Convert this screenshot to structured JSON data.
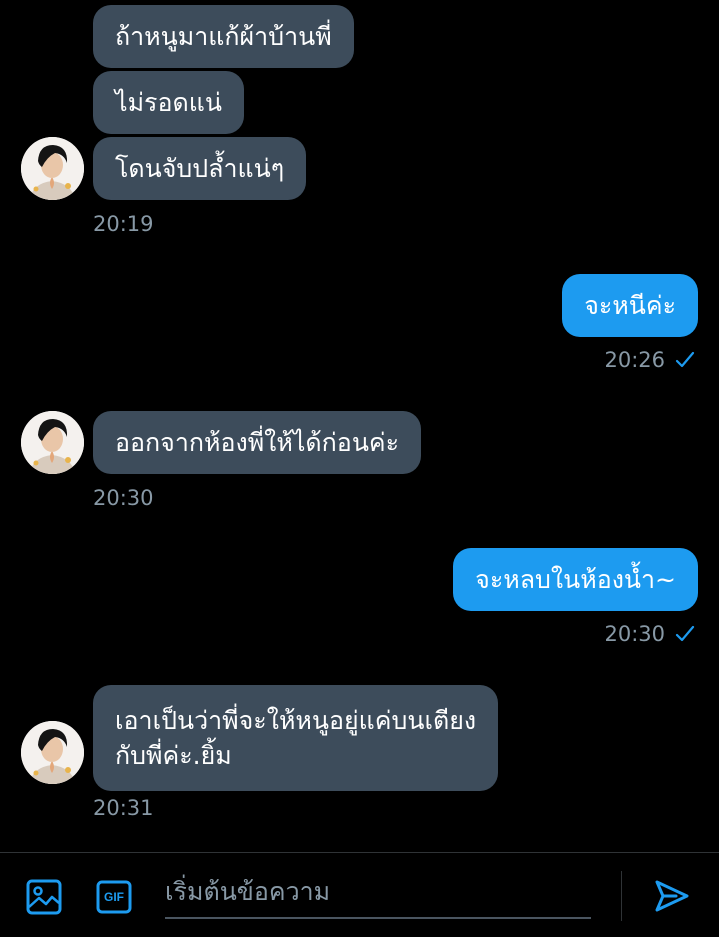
{
  "colors": {
    "background": "#000000",
    "incoming_bubble": "#3d4c5b",
    "outgoing_bubble": "#1d9bf0",
    "timestamp": "#8899a6",
    "accent": "#1d9bf0"
  },
  "messages": [
    {
      "direction": "in",
      "text": "ถ้าหนูมาแก้ผ้าบ้านพี่"
    },
    {
      "direction": "in",
      "text": "ไม่รอดแน่"
    },
    {
      "direction": "in",
      "text": "โดนจับปล้ำแน่ๆ"
    },
    {
      "direction": "in",
      "time": "20:19"
    },
    {
      "direction": "out",
      "text": "จะหนีค่ะ",
      "time": "20:26",
      "status_icon": "check-icon"
    },
    {
      "direction": "in",
      "text": "ออกจากห้องพี่ให้ได้ก่อนค่ะ",
      "time": "20:30"
    },
    {
      "direction": "out",
      "text": "จะหลบในห้องน้ำ~",
      "time": "20:30",
      "status_icon": "check-icon"
    },
    {
      "direction": "in",
      "lines": [
        "เอาเป็นว่าพี่จะให้หนูอยู่แค่บนเตียง",
        "กับพี่ค่ะ.ยิ้ม"
      ],
      "time": "20:31"
    }
  ],
  "composer": {
    "placeholder": "เริ่มต้นข้อความ",
    "value": "",
    "gif_label": "GIF",
    "icons": [
      "image-icon",
      "gif-icon",
      "send-icon"
    ]
  }
}
